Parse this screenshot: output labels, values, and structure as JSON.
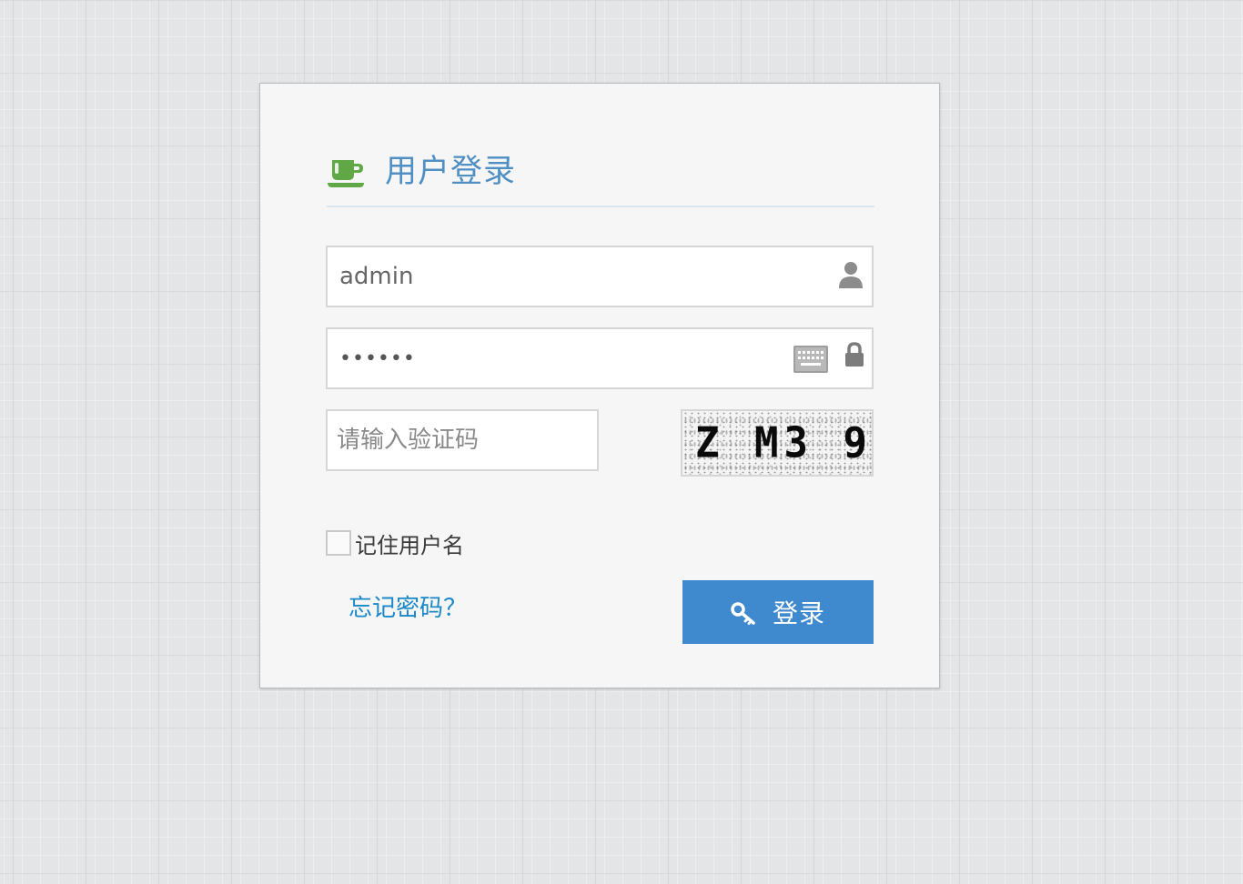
{
  "login": {
    "title": "用户登录",
    "username": {
      "value": "admin",
      "icon": "user-icon"
    },
    "password": {
      "value": "••••••",
      "icons": [
        "keyboard-icon",
        "lock-icon"
      ]
    },
    "captcha": {
      "placeholder": "请输入验证码",
      "value": "",
      "image_text": "Z M3 9"
    },
    "remember": {
      "label": "记住用户名",
      "checked": false
    },
    "forgot_link": "忘记密码？",
    "submit": {
      "label": "登录",
      "icon": "key-icon"
    },
    "header_icon": "coffee-cup-icon"
  },
  "colors": {
    "accent_blue": "#3f8ace",
    "title_blue": "#4f8fc3",
    "link_blue": "#1b88c8",
    "cup_green": "#5fa845",
    "panel_bg": "#f6f6f6",
    "page_bg": "#e4e5e7"
  }
}
